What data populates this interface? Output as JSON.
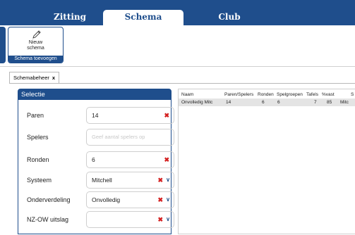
{
  "top_tabs": [
    "Zitting",
    "Schema",
    "Club"
  ],
  "ribbon": {
    "new_schema_label_line1": "Nieuw",
    "new_schema_label_line2": "schema",
    "group_label": "Schema toevoegen"
  },
  "doc_tab": {
    "label": "Schemabeheer",
    "close": "x"
  },
  "selectie": {
    "title": "Selectie",
    "fields": {
      "paren": {
        "label": "Paren",
        "value": "14"
      },
      "spelers": {
        "label": "Spelers",
        "placeholder": "Geef aantal spelers op"
      },
      "ronden": {
        "label": "Ronden",
        "value": "6"
      },
      "systeem": {
        "label": "Systeem",
        "value": "Mitchell"
      },
      "onderverdeling": {
        "label": "Onderverdeling",
        "value": "Onvolledig"
      },
      "nzow": {
        "label": "NZ-OW uitslag",
        "value": ""
      }
    }
  },
  "table": {
    "columns": [
      "Naam",
      "Paren/Spelers",
      "Ronden",
      "Spelgroepen",
      "Tafels",
      "%vast",
      "S"
    ],
    "rows": [
      [
        "Onvolledig Mitc",
        "14",
        "6",
        "6",
        "7",
        "85",
        "Mitc"
      ]
    ]
  },
  "colors": {
    "accent": "#1f4e8c",
    "error": "#d42020"
  },
  "icons": [
    "pencil-icon",
    "close-icon",
    "clear-icon",
    "chevron-down-icon"
  ]
}
